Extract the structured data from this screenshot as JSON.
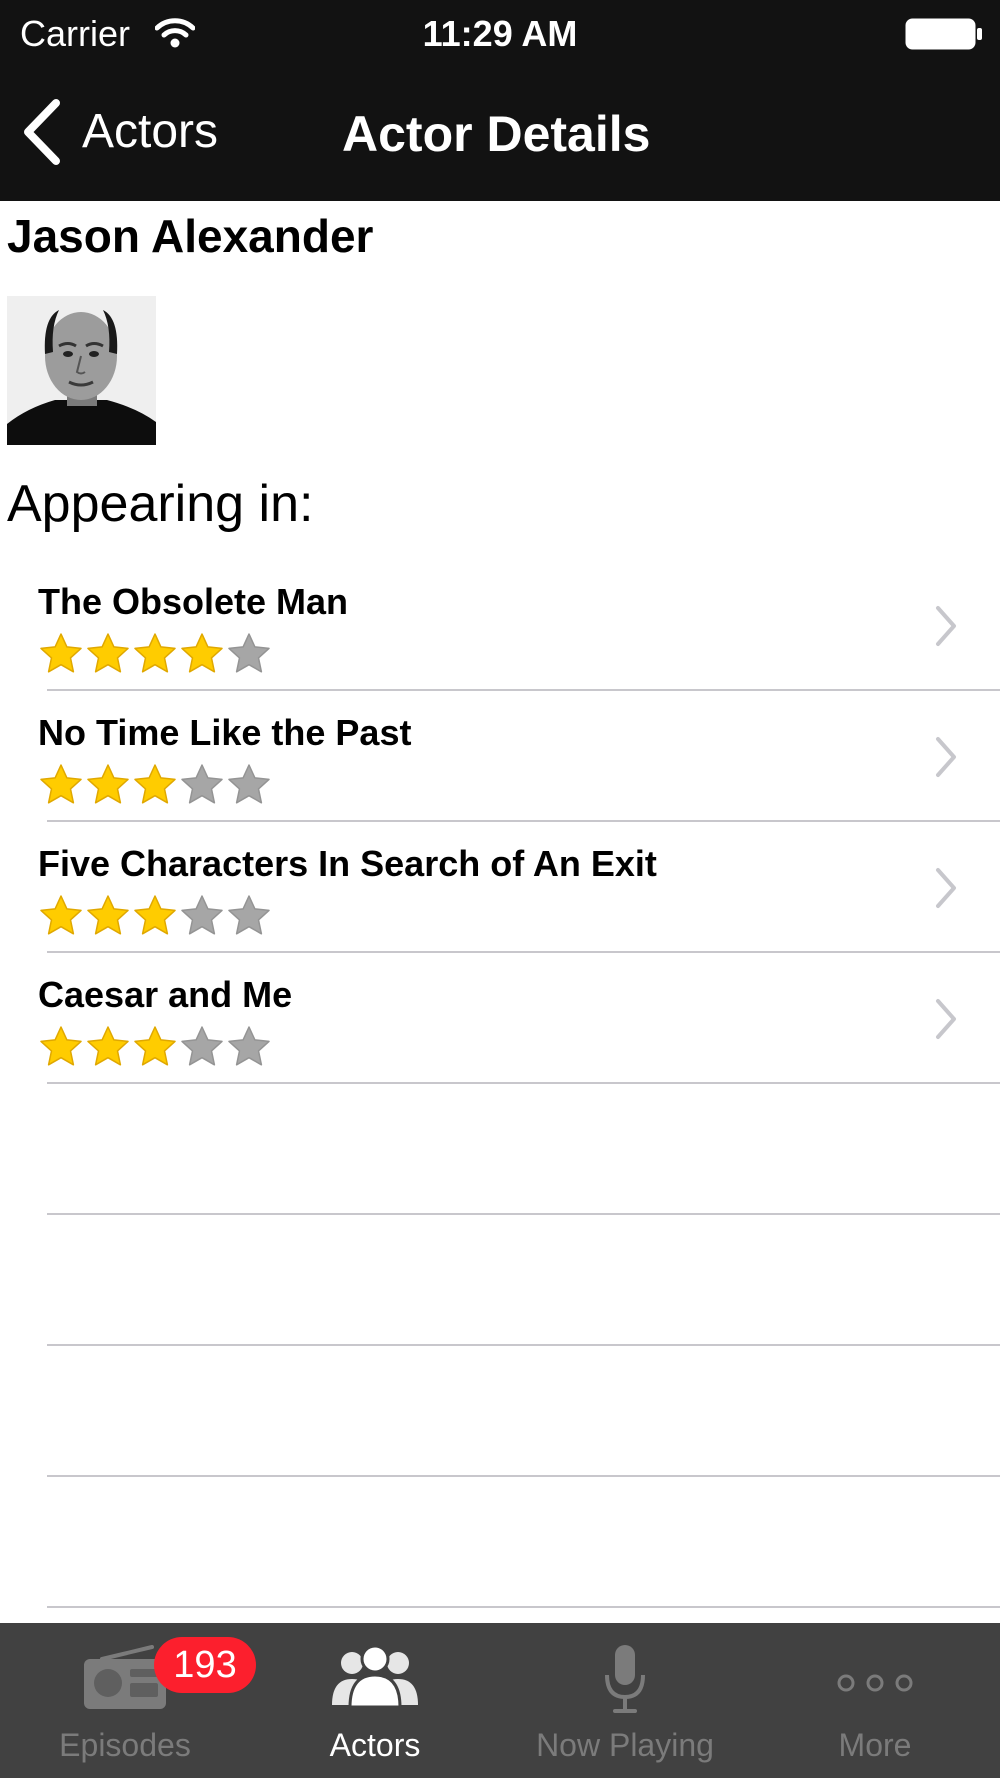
{
  "status_bar": {
    "carrier": "Carrier",
    "time": "11:29 AM"
  },
  "nav": {
    "back_label": "Actors",
    "title": "Actor Details"
  },
  "actor": {
    "name": "Jason Alexander"
  },
  "section_heading": "Appearing in:",
  "episodes": [
    {
      "title": "The Obsolete Man",
      "rating": 4,
      "max_rating": 5
    },
    {
      "title": "No Time Like the Past",
      "rating": 3,
      "max_rating": 5
    },
    {
      "title": "Five Characters In Search of An Exit",
      "rating": 3,
      "max_rating": 5
    },
    {
      "title": "Caesar and Me",
      "rating": 3,
      "max_rating": 5
    }
  ],
  "tabs": [
    {
      "label": "Episodes",
      "icon": "radio-icon",
      "badge": "193",
      "active": false
    },
    {
      "label": "Actors",
      "icon": "people-icon",
      "active": true
    },
    {
      "label": "Now Playing",
      "icon": "microphone-icon",
      "active": false
    },
    {
      "label": "More",
      "icon": "more-dots-icon",
      "active": false
    }
  ],
  "colors": {
    "bar_background": "#121212",
    "tab_bar_background": "#414141",
    "star_filled": "#ffcc00",
    "star_empty": "#a6a6a6",
    "badge": "#fc1f2d",
    "separator": "#c8c7cc",
    "chevron": "#c7c7cc"
  }
}
